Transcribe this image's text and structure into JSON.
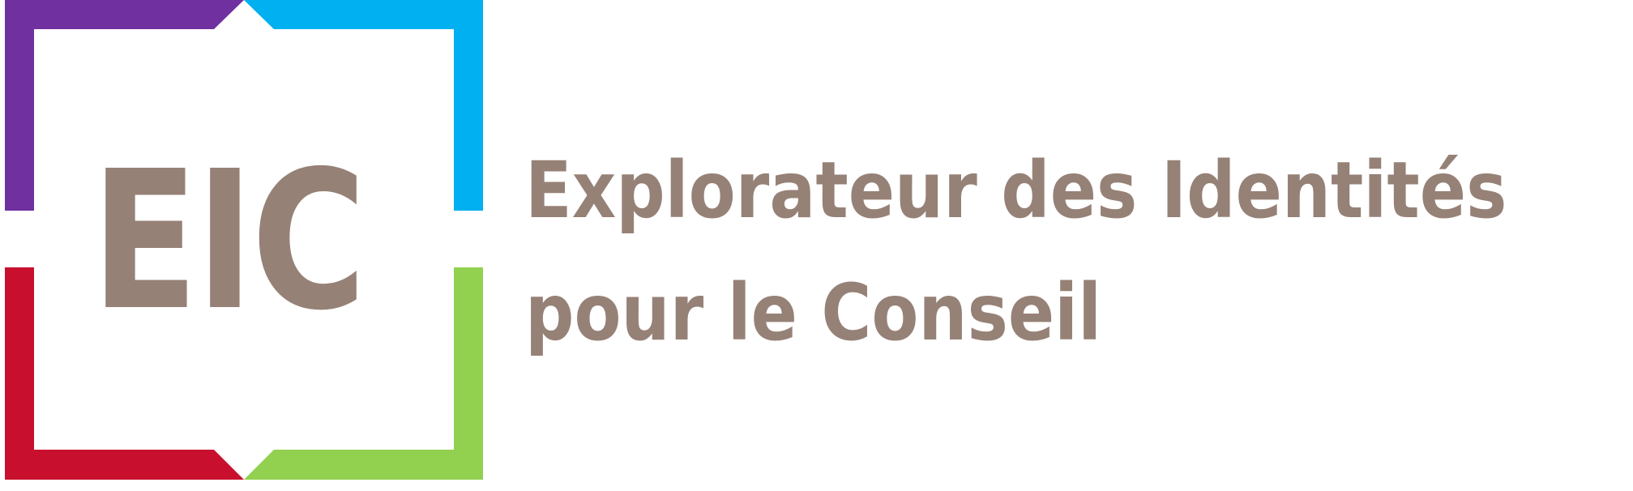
{
  "logo": {
    "monogram": "EIC",
    "colors": {
      "top_left": "#7030A0",
      "top_right": "#00B0F0",
      "bottom_left": "#C8102E",
      "bottom_right": "#92D050",
      "text": "#968177"
    }
  },
  "tagline": {
    "line1": "Explorateur des Identités",
    "line2": "pour le Conseil"
  }
}
